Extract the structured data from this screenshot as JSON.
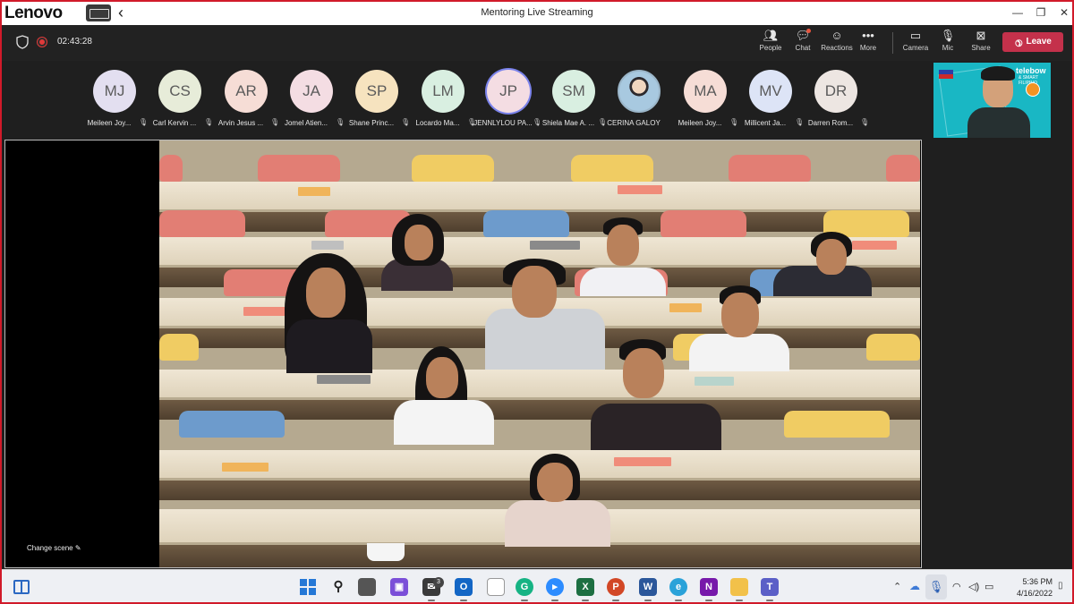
{
  "titlebar": {
    "logo": "Lenovo",
    "title": "Mentoring Live Streaming",
    "minimize": "—",
    "maximize": "❐",
    "close": "✕"
  },
  "toolbar": {
    "timer": "02:43:28",
    "people_label": "People",
    "chat_label": "Chat",
    "reactions_label": "Reactions",
    "more_label": "More",
    "camera_label": "Camera",
    "mic_label": "Mic",
    "share_label": "Share",
    "leave_label": "Leave",
    "leave_color": "#c4314b"
  },
  "participants": [
    {
      "initials": "MJ",
      "name": "Meileen Joy...",
      "color": "#e3dff0"
    },
    {
      "initials": "CS",
      "name": "Carl Kervin ...",
      "color": "#e7ecd9"
    },
    {
      "initials": "AR",
      "name": "Arvin Jesus ...",
      "color": "#f6ddd6"
    },
    {
      "initials": "JA",
      "name": "Jomel Atien...",
      "color": "#f4dde3"
    },
    {
      "initials": "SP",
      "name": "Shane Princ...",
      "color": "#f6e3bf"
    },
    {
      "initials": "LM",
      "name": "Locardo Ma...",
      "color": "#d9efe1"
    },
    {
      "initials": "JP",
      "name": "JENNLYLOU PA...",
      "color": "#f4dde3",
      "speaking": true
    },
    {
      "initials": "SM",
      "name": "Shiela Mae A. ...",
      "color": "#d9efe1"
    },
    {
      "initials": "",
      "name": "CERINA GALOY",
      "color": "#a8c9e0",
      "photo": true,
      "no_mute": true
    },
    {
      "initials": "MA",
      "name": "Meileen Joy...",
      "color": "#f6ddd6"
    },
    {
      "initials": "MV",
      "name": "Millicent Ja...",
      "color": "#dde4f6"
    },
    {
      "initials": "DR",
      "name": "Darren Rom...",
      "color": "#ede6e2"
    }
  ],
  "self_view": {
    "brand": "telebow",
    "brand_sub": "& SMART FILIPINO"
  },
  "stage": {
    "change_scene": "Change scene ✎"
  },
  "taskbar": {
    "app_badge": "3",
    "clock_time": "5:36 PM",
    "clock_date": "4/16/2022"
  }
}
